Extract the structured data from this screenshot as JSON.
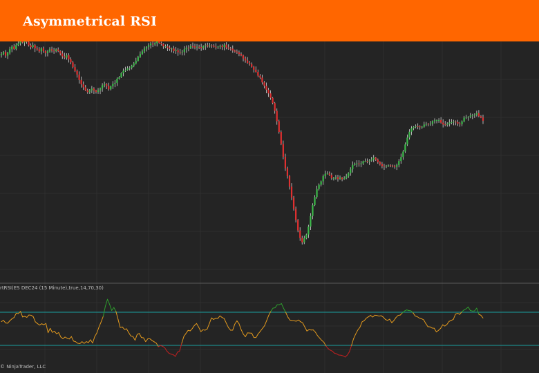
{
  "header": {
    "title": "Asymmetrical RSI"
  },
  "indicator_label": "rtRSI(ES DEC24 (15 Minute),true,14,70,30)",
  "copyright": "© NinjaTrader, LLC",
  "colors": {
    "header": "#ff6600",
    "background": "#242424",
    "grid": "#2e2e2e",
    "up_candle": "#3cba4a",
    "down_candle": "#e03030",
    "wick": "#d8d8d8",
    "rsi_mid": "#e39a1e",
    "rsi_over": "#2e9e2e",
    "rsi_under": "#c42020",
    "levels": "#1aa0a0"
  },
  "chart_data": [
    {
      "type": "candlestick",
      "title": "",
      "xlabel": "",
      "ylabel": "",
      "ylim": [
        0,
        100
      ],
      "grid": true,
      "x": [
        1,
        2,
        3,
        4,
        5,
        6,
        7,
        8,
        9,
        10,
        11,
        12,
        13,
        14,
        15,
        16,
        17,
        18,
        19,
        20,
        21,
        22,
        23,
        24,
        25,
        26,
        27,
        28,
        29,
        30,
        31,
        32,
        33,
        34,
        35,
        36,
        37,
        38,
        39,
        40,
        41,
        42,
        43,
        44,
        45,
        46,
        47,
        48,
        49,
        50,
        51,
        52,
        53,
        54,
        55,
        56,
        57,
        58,
        59,
        60,
        61,
        62,
        63,
        64,
        65,
        66,
        67,
        68,
        69,
        70,
        71,
        72,
        73,
        74,
        75,
        76,
        77,
        78,
        79,
        80,
        81,
        82,
        83,
        84,
        85,
        86,
        87,
        88,
        89,
        90,
        91,
        92,
        93,
        94,
        95,
        96,
        97,
        98,
        99,
        100,
        101,
        102,
        103,
        104,
        105,
        106,
        107,
        108,
        109,
        110,
        111,
        112,
        113,
        114,
        115,
        116,
        117,
        118,
        119,
        120,
        121,
        122,
        123,
        124,
        125,
        126,
        127,
        128,
        129,
        130,
        131,
        132,
        133,
        134,
        135,
        136,
        137,
        138,
        139,
        140,
        141,
        142,
        143,
        144,
        145,
        146,
        147,
        148,
        149,
        150,
        151,
        152,
        153,
        154,
        155,
        156,
        157,
        158,
        159,
        160,
        161,
        162,
        163,
        164,
        165,
        166,
        167,
        168,
        169,
        170,
        171,
        172,
        173,
        174,
        175,
        176,
        177,
        178,
        179,
        180,
        181,
        182,
        183,
        184,
        185,
        186,
        187,
        188,
        189,
        190,
        191,
        192,
        193,
        194,
        195,
        196,
        197,
        198,
        199,
        200,
        201,
        202,
        203,
        204,
        205,
        206,
        207,
        208,
        209,
        210,
        211,
        212,
        213,
        214,
        215,
        216,
        217,
        218,
        219,
        220,
        221,
        222,
        223,
        224,
        225,
        226,
        227,
        228,
        229,
        230
      ],
      "close": [
        94.2,
        95.1,
        93.4,
        94.8,
        96.4,
        97.6,
        96.5,
        98.3,
        99.1,
        100.4,
        99.5,
        100.6,
        99.8,
        98.2,
        97.4,
        98.3,
        96.8,
        96.3,
        95.4,
        96.8,
        95.5,
        94.6,
        95.4,
        96.4,
        95.7,
        95.5,
        96.3,
        95.5,
        94.4,
        93.1,
        92.5,
        93.6,
        91.7,
        90.3,
        88.1,
        86.3,
        84.6,
        82.1,
        80.1,
        78.7,
        77.3,
        76.5,
        77.3,
        78.1,
        77.3,
        76.6,
        77.3,
        78.2,
        79.7,
        80.2,
        79.3,
        77.8,
        79.2,
        80.3,
        80.8,
        82.7,
        83.4,
        85.3,
        86.4,
        86.8,
        87.5,
        87.8,
        88.8,
        89.8,
        91.0,
        92.8,
        94.2,
        95.4,
        96.7,
        97.5,
        98.3,
        99.0,
        98.6,
        99.2,
        100.0,
        99.3,
        98.8,
        97.7,
        97.7,
        97.1,
        96.5,
        96.7,
        95.5,
        95.9,
        95.0,
        94.8,
        95.1,
        96.4,
        97.1,
        96.9,
        97.8,
        97.7,
        97.2,
        97.5,
        97.4,
        96.9,
        97.8,
        98.2,
        97.7,
        98.1,
        98.0,
        97.5,
        97.3,
        97.6,
        98.0,
        97.4,
        98.5,
        97.2,
        96.7,
        96.6,
        95.8,
        95.3,
        94.9,
        94.2,
        93.5,
        92.1,
        91.2,
        90.1,
        89.4,
        88.2,
        86.9,
        85.9,
        84.1,
        83.2,
        81.0,
        79.4,
        77.6,
        75.9,
        73.8,
        71.4,
        67.8,
        63.0,
        58.0,
        52.4,
        46.5,
        41.2,
        37.5,
        32.6,
        27.5,
        22.3,
        17.1,
        12.3,
        8.8,
        6.8,
        8.7,
        10.4,
        14.1,
        19.0,
        24.0,
        27.8,
        31.5,
        33.5,
        35.1,
        37.5,
        38.6,
        38.7,
        38.1,
        36.5,
        36.5,
        37.0,
        36.2,
        36.8,
        36.1,
        36.5,
        37.4,
        38.9,
        40.7,
        42.7,
        43.3,
        43.4,
        43.2,
        43.4,
        44.4,
        44.5,
        44.3,
        44.7,
        45.3,
        46.1,
        45.2,
        44.0,
        43.1,
        42.2,
        42.0,
        42.3,
        42.5,
        42.4,
        42.3,
        41.8,
        42.6,
        44.5,
        46.4,
        48.9,
        52.2,
        55.4,
        58.1,
        59.8,
        60.3,
        60.6,
        60.5,
        60.4,
        60.4,
        61.4,
        61.8,
        61.6,
        61.8,
        63.0,
        63.4,
        63.5,
        63.5,
        62.3,
        61.5,
        61.3,
        61.8,
        62.4,
        62.5,
        62.8,
        62.5,
        61.9,
        61.6,
        62.9,
        64.6,
        64.9,
        65.0,
        65.6,
        65.8,
        66.0,
        66.7,
        65.3,
        64.7,
        63.2
      ]
    },
    {
      "type": "line",
      "title": "",
      "xlabel": "",
      "ylabel": "",
      "ylim": [
        0,
        100
      ],
      "levels": [
        70,
        30
      ],
      "grid": true,
      "series": [
        {
          "values": [
            58.7,
            60.2,
            57.0,
            56.8,
            59.8,
            62.1,
            63.7,
            68.8,
            68.3,
            71.0,
            64.3,
            65.0,
            63.8,
            66.7,
            66.3,
            64.7,
            58.4,
            56.3,
            54.5,
            56.1,
            54.9,
            56.4,
            45.3,
            50.5,
            45.7,
            47.1,
            44.0,
            45.4,
            40.1,
            38.0,
            40.1,
            38.6,
            37.7,
            40.6,
            35.2,
            34.4,
            32.5,
            32.1,
            34.5,
            32.4,
            34.5,
            33.4,
            36.8,
            32.8,
            40.6,
            45.0,
            52.1,
            58.3,
            65.0,
            77.2,
            85.6,
            79.5,
            72.1,
            75.7,
            70.9,
            61.3,
            51.6,
            52.2,
            49.3,
            50.0,
            45.4,
            41.3,
            40.6,
            36.2,
            43.2,
            44.4,
            39.5,
            39.1,
            34.5,
            37.9,
            37.9,
            35.9,
            34.3,
            32.7,
            28.5,
            29.7,
            28.9,
            27.1,
            23.1,
            20.4,
            19.4,
            18.7,
            16.7,
            21.8,
            23.2,
            32.6,
            40.8,
            44.4,
            48.1,
            47.5,
            50.4,
            54.2,
            56.4,
            51.9,
            46.6,
            48.8,
            48.3,
            49.7,
            56.2,
            63.1,
            61.3,
            62.7,
            62.4,
            65.6,
            63.7,
            62.3,
            56.8,
            51.5,
            48.3,
            48.3,
            55.6,
            59.6,
            56.1,
            49.0,
            43.7,
            40.4,
            45.1,
            44.9,
            44.7,
            39.5,
            39.5,
            43.8,
            46.8,
            50.3,
            53.6,
            59.7,
            66.3,
            71.1,
            74.9,
            75.4,
            79.0,
            79.1,
            80.4,
            74.7,
            69.9,
            64.2,
            60.5,
            59.6,
            59.6,
            59.2,
            60.6,
            58.6,
            57.1,
            52.2,
            47.3,
            49.0,
            48.5,
            48.6,
            45.9,
            41.7,
            38.8,
            36.0,
            33.7,
            29.2,
            26.1,
            24.2,
            23.0,
            20.5,
            19.8,
            18.3,
            18.1,
            17.4,
            15.9,
            18.2,
            22.2,
            29.8,
            38.2,
            43.8,
            48.6,
            51.9,
            58.4,
            59.8,
            62.9,
            64.5,
            66.2,
            64.2,
            66.4,
            66.1,
            65.3,
            65.8,
            64.0,
            61.2,
            60.1,
            61.6,
            57.3,
            60.0,
            63.7,
            66.2,
            66.6,
            69.2,
            71.5,
            72.8,
            72.1,
            71.7,
            69.3,
            65.5,
            64.6,
            62.9,
            62.1,
            60.9,
            56.5,
            52.6,
            52.3,
            50.9,
            50.6,
            46.2,
            48.1,
            50.5,
            54.8,
            53.3,
            55.3,
            58.9,
            60.1,
            61.3,
            67.6,
            68.7,
            67.4,
            70.5,
            72.7,
            74.0,
            76.3,
            72.1,
            71.4,
            71.6,
            74.9,
            67.6,
            66.3,
            63.0
          ]
        }
      ]
    }
  ]
}
